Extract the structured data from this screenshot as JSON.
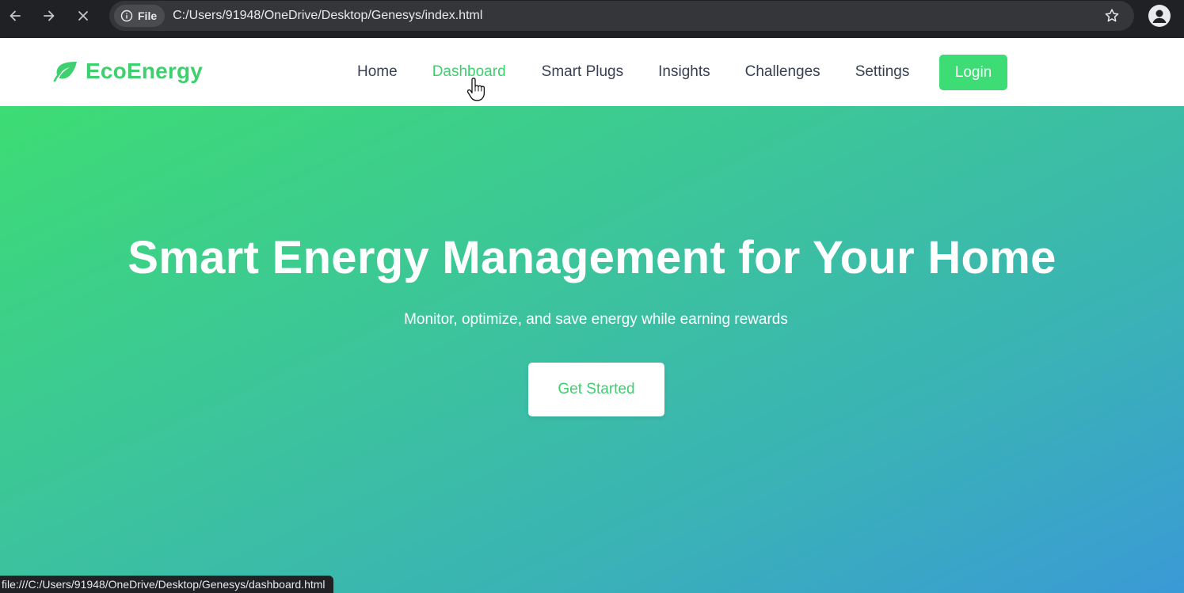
{
  "browser": {
    "site_chip_label": "File",
    "url": "C:/Users/91948/OneDrive/Desktop/Genesys/index.html",
    "status_url": "file:///C:/Users/91948/OneDrive/Desktop/Genesys/dashboard.html",
    "icons": {
      "back": "arrow-left-icon",
      "forward": "arrow-right-icon",
      "stop": "close-icon",
      "info": "info-icon",
      "bookmark": "star-icon",
      "profile": "profile-icon"
    }
  },
  "site": {
    "brand": "EcoEnergy",
    "brand_icon": "leaf-icon",
    "nav": [
      {
        "label": "Home",
        "active": false
      },
      {
        "label": "Dashboard",
        "active": true
      },
      {
        "label": "Smart Plugs",
        "active": false
      },
      {
        "label": "Insights",
        "active": false
      },
      {
        "label": "Challenges",
        "active": false
      },
      {
        "label": "Settings",
        "active": false
      }
    ],
    "login_label": "Login"
  },
  "hero": {
    "title": "Smart Energy Management for Your Home",
    "subtitle": "Monitor, optimize, and save energy while earning rewards",
    "cta_label": "Get Started"
  },
  "colors": {
    "accent": "#3ecf6e",
    "login_bg": "#3ddc74",
    "gradient_start": "#3ddc74",
    "gradient_end": "#3a9ad6",
    "nav_text": "#374151",
    "chrome_bg": "#202124"
  }
}
